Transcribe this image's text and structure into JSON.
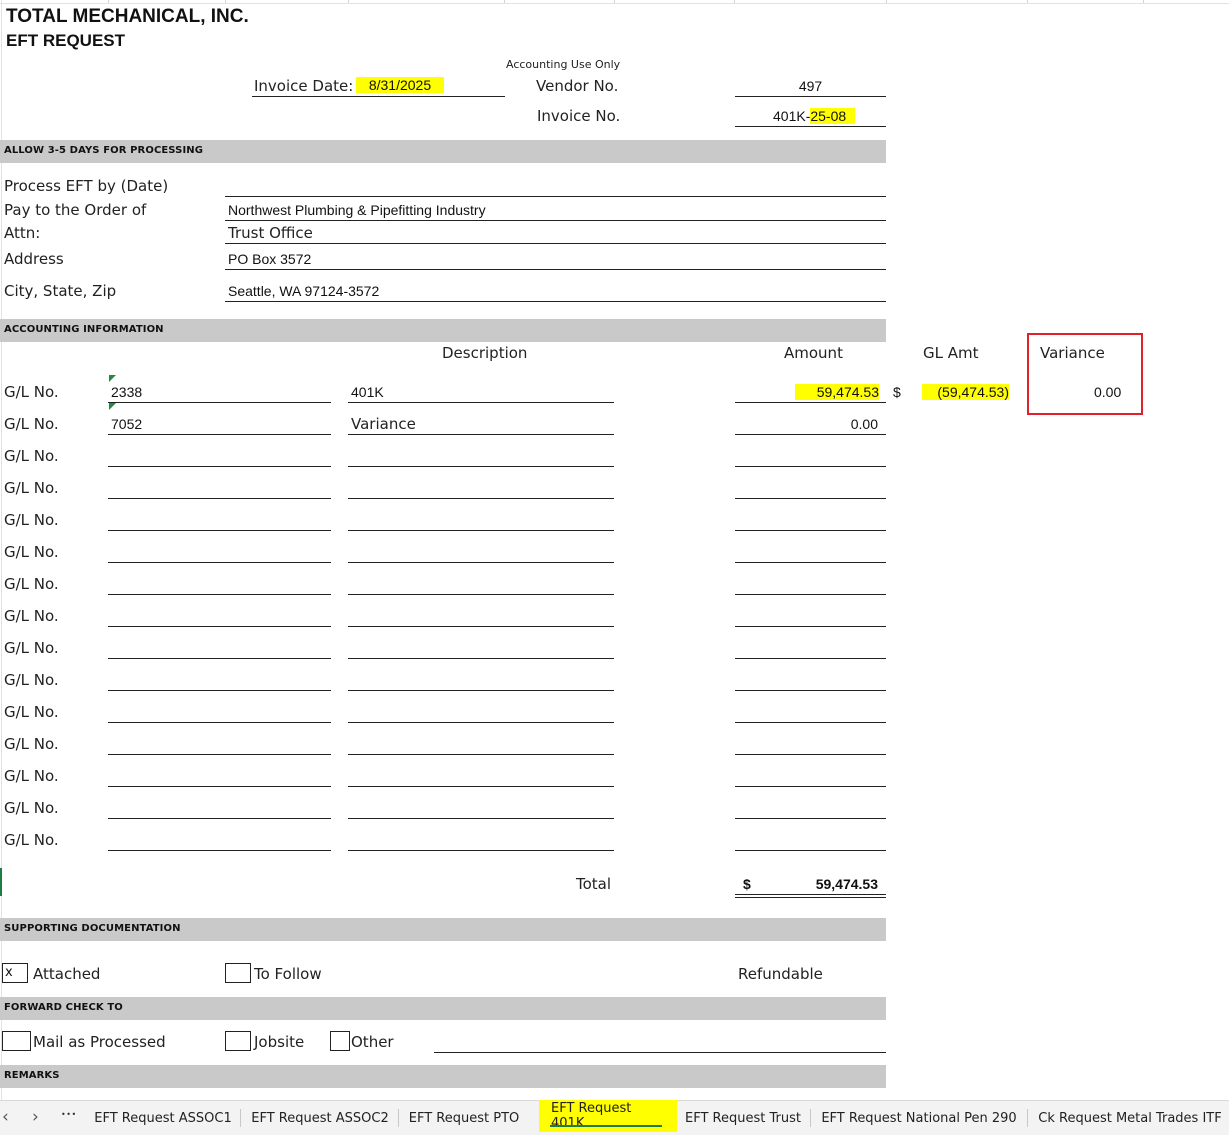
{
  "company": {
    "name": "TOTAL MECHANICAL, INC.",
    "form_title": "EFT REQUEST"
  },
  "header": {
    "invoice_date_label": "Invoice Date:",
    "invoice_date_value": "8/31/2025",
    "accounting_use_only": "Accounting Use Only",
    "vendor_no_label": "Vendor No.",
    "vendor_no_value": "497",
    "invoice_no_label": "Invoice No.",
    "invoice_no_prefix": "401K-",
    "invoice_no_suffix": "25-08"
  },
  "sections": {
    "processing": "ALLOW 3-5 DAYS FOR PROCESSING",
    "accounting": "ACCOUNTING INFORMATION",
    "supporting": "SUPPORTING DOCUMENTATION",
    "forward": "FORWARD CHECK TO",
    "remarks": "REMARKS"
  },
  "payee": {
    "process_label": "Process EFT by (Date)",
    "pay_to_label": "Pay to the Order of",
    "pay_to_value": "Northwest Plumbing & Pipefitting Industry",
    "attn_label": "Attn:",
    "attn_value": "Trust Office",
    "address_label": "Address",
    "address_value": "PO Box 3572",
    "city_label": "City, State, Zip",
    "city_value": "Seattle, WA 97124-3572"
  },
  "accounting": {
    "col_description": "Description",
    "col_amount": "Amount",
    "col_gl_amt": "GL Amt",
    "col_variance": "Variance",
    "gl_label": "G/L No.",
    "rows": [
      {
        "gl": "2338",
        "description": "401K",
        "amount": "59,474.53",
        "dollar": "$",
        "gl_amt": "(59,474.53)",
        "variance": "0.00"
      },
      {
        "gl": "7052",
        "description": "Variance",
        "amount": "0.00"
      }
    ],
    "total_label": "Total",
    "total_currency": "$",
    "total_value": "59,474.53"
  },
  "supporting": {
    "attached_mark": "x",
    "attached_label": "Attached",
    "to_follow_label": "To Follow",
    "refundable_label": "Refundable"
  },
  "forward": {
    "mail_label": "Mail as Processed",
    "jobsite_label": "Jobsite",
    "other_label": "Other"
  },
  "tabs": {
    "nav_prev": "‹",
    "nav_next": "›",
    "nav_more": "•••",
    "items": [
      "EFT Request ASSOC1",
      "EFT Request ASSOC2",
      "EFT Request PTO",
      "EFT Request 401K",
      "EFT Request Trust",
      "EFT Request National Pen 290",
      "Ck Request Metal Trades ITF"
    ],
    "active_index": 3
  },
  "colors": {
    "highlight": "#ffff00",
    "band": "#c9c9c9",
    "red_box": "#e0202a",
    "active_tab_underline": "#1e7d45",
    "comment_marker": "#1e8c3a"
  }
}
